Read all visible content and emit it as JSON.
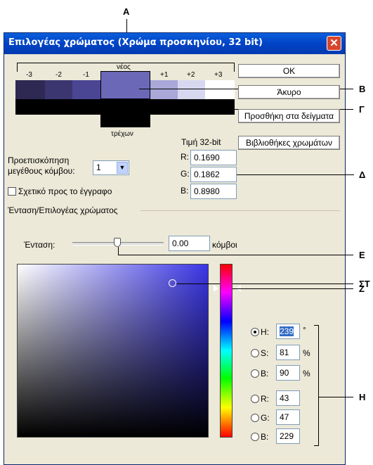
{
  "window": {
    "title": "Επιλογέας χρώματος (Χρώμα προσκηνίου, 32 bit)",
    "close_glyph": "✕"
  },
  "preview": {
    "new_label": "νέος",
    "current_label": "τρέχων",
    "stops": [
      "-3",
      "-2",
      "-1",
      "+1",
      "+2",
      "+3"
    ],
    "new_swatches": [
      "#2e2952",
      "#3b3670",
      "#4a4693",
      "#6c68b8",
      "#a9a8d8",
      "#d7d8ef",
      "#ffffff"
    ],
    "current_color": "#000000"
  },
  "buttons": {
    "ok": "OK",
    "cancel": "Άκυρο",
    "add_to_swatches": "Προσθήκη στα δείγματα",
    "color_libraries": "Βιβλιοθήκες χρωμάτων"
  },
  "stop_size": {
    "label_line1": "Προεπισκόπηση",
    "label_line2": "μεγέθους κόμβου:",
    "value": "1"
  },
  "relative_doc": {
    "label": "Σχετικό προς το έγγραφο"
  },
  "value32": {
    "title": "Τιμή 32-bit",
    "r_label": "R:",
    "r": "0.1690",
    "g_label": "G:",
    "g": "0.1862",
    "b_label": "B:",
    "b": "0.8980"
  },
  "section": {
    "title": "Ένταση/Επιλογέας χρώματος"
  },
  "intensity": {
    "label": "Ένταση:",
    "value": "0.00",
    "unit": "κόμβοι"
  },
  "hsb_rgb": {
    "h_label": "H:",
    "h": "239",
    "h_unit": "°",
    "s_label": "S:",
    "s": "81",
    "s_unit": "%",
    "b_label": "B:",
    "b": "90",
    "b_unit": "%",
    "r_label": "R:",
    "r": "43",
    "g_label": "G:",
    "g": "47",
    "b2_label": "B:",
    "b2": "229"
  },
  "callouts": {
    "a": "A",
    "b": "B",
    "c": "Γ",
    "d": "Δ",
    "e": "E",
    "f": "ΣΤ",
    "z": "Z",
    "h": "H"
  },
  "colors": {
    "field_hue": "#3a35e5",
    "title_bg": "#0050d8"
  }
}
